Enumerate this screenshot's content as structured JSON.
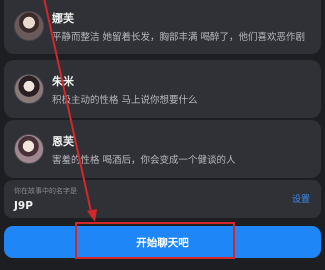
{
  "characters": [
    {
      "name": "娜芙",
      "description": "平静而整洁 她留着长发，胸部丰满 喝醉了，他们喜欢恶作剧"
    },
    {
      "name": "朱米",
      "description": "积极主动的性格 马上说你想要什么"
    },
    {
      "name": "恩芙",
      "description": "害羞的性格 喝酒后，你会变成一个健谈的人"
    }
  ],
  "story_name": {
    "label": "你在故事中的名字是",
    "value": "J9P",
    "settings_label": "设置"
  },
  "start_button": {
    "label": "开始聊天吧"
  },
  "colors": {
    "background": "#1c1e22",
    "card": "#2f3136",
    "accent": "#1f86f7",
    "link": "#3b8cf5",
    "annotation": "#d4262b"
  }
}
